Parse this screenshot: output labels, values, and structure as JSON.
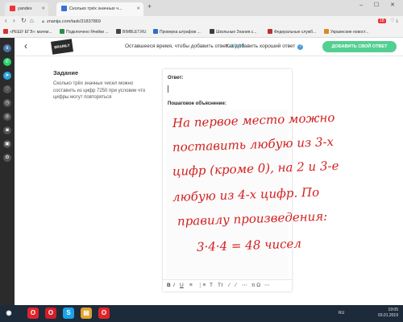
{
  "browser": {
    "tabs": [
      {
        "label": "yandex",
        "color": "#e33"
      },
      {
        "label": "Сколько трёх значных ч...",
        "color": "#3a6fd8"
      }
    ],
    "new_tab": "+",
    "window_controls": "– ☐ ✕",
    "url": "znanija.com/task/31837869",
    "badge": "18",
    "bookmarks": [
      {
        "label": "«РЕШУ ЕГЭ»: матем...",
        "color": "#c33"
      },
      {
        "label": "Подключено Ячейки ...",
        "color": "#2a8c4a"
      },
      {
        "label": "BIMBLET.RU",
        "color": "#444"
      },
      {
        "label": "Проверка штрафов ...",
        "color": "#2d6fc4"
      },
      {
        "label": "Школьные Знания.c...",
        "color": "#3c3c3c"
      },
      {
        "label": "Федеральные служб...",
        "color": "#c02e2e"
      },
      {
        "label": "Украинские новост...",
        "color": "#d98a1e"
      }
    ]
  },
  "sidebar_icons": [
    {
      "name": "vk-icon",
      "color": "#4a76a8",
      "glyph": "в"
    },
    {
      "name": "whatsapp-icon",
      "color": "#25d366",
      "glyph": "✆"
    },
    {
      "name": "telegram-icon",
      "color": "#2ca5e0",
      "glyph": "➤"
    },
    {
      "name": "bookmark-icon",
      "color": "#555",
      "glyph": "♡"
    },
    {
      "name": "history-icon",
      "color": "#555",
      "glyph": "◷"
    },
    {
      "name": "speed-icon",
      "color": "#555",
      "glyph": "◎"
    },
    {
      "name": "camera-icon",
      "color": "#555",
      "glyph": "◙"
    },
    {
      "name": "news-icon",
      "color": "#555",
      "glyph": "▣"
    },
    {
      "name": "settings-icon",
      "color": "#555",
      "glyph": "⚙"
    }
  ],
  "header": {
    "logo": "BRAINLY",
    "timer_label": "Оставшееся время, чтобы добавить ответ:",
    "timer_value": "19:03",
    "howto": "Как добавить хороший ответ",
    "help_icon": "?",
    "add_button": "ДОБАВИТЬ СВОЙ ОТВЕТ"
  },
  "task": {
    "title": "Задание",
    "text": "Сколько трёх значных чисел можно составить из цифр 7250 при условии что цифры могут повторяться"
  },
  "answer": {
    "answer_label": "Ответ:",
    "explanation_label": "Пошаговое объяснение:",
    "handwriting": [
      "На первое место можно",
      "поставить любую из 3-х",
      "цифр (кроме 0), на 2 и 3-е",
      "любую из 4-х цифр. По",
      "правилу произведения:",
      "3·4·4 = 48 чисел"
    ],
    "handwriting_color": "#d42020",
    "toolbar": [
      "B",
      "I",
      "U",
      "≡",
      "⋮≡",
      "T",
      "Tт",
      "⁄",
      "⁄",
      "⋯",
      "π Ω",
      "⋯"
    ]
  },
  "taskbar": {
    "apps": [
      {
        "name": "start-icon",
        "glyph": "◉",
        "color": "#1d2a3a"
      },
      {
        "name": "opera-icon",
        "glyph": "O",
        "color": "#e0242b"
      },
      {
        "name": "opera-gx-icon",
        "glyph": "O",
        "color": "#d01e2a"
      },
      {
        "name": "skype-icon",
        "glyph": "S",
        "color": "#1aa3e8"
      },
      {
        "name": "explorer-icon",
        "glyph": "▤",
        "color": "#e0a22b"
      },
      {
        "name": "opera-task-icon",
        "glyph": "O",
        "color": "#e0242b"
      }
    ],
    "lang": "RU",
    "time": "19:05",
    "date": "03.01.2019"
  }
}
